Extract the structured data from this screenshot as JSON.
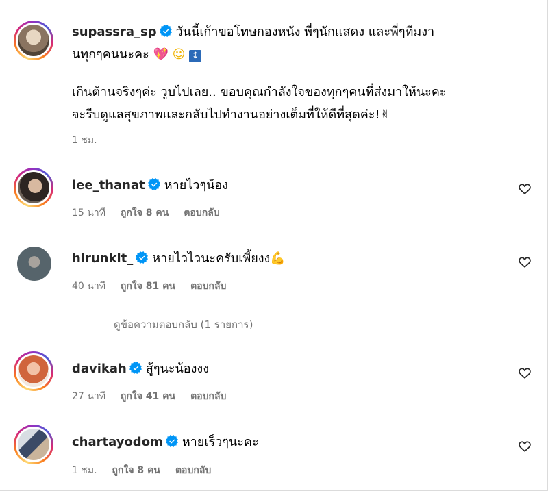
{
  "caption": {
    "username": "supassra_sp",
    "line1": "วันนี้เก้าขอโทษกองหนัง พี่ๆนักแสดง และพี่ๆทีมงา",
    "line2": "นทุกๆคนนะคะ",
    "line2_emoji_1": "💖",
    "line2_emoji_2": "☺",
    "line2_emoji_3": "↕",
    "line3": "เกินต้านจริงๆค่ะ วูบไปเลย.. ขอบคุณกำลังใจของทุกๆคนที่ส่งมาให้นะคะ",
    "line4": "จะรีบดูแลสุขภาพและกลับไปทำงานอย่างเต็มที่ให้ดีที่สุดค่ะ!✌",
    "time": "1 ชม."
  },
  "comments": [
    {
      "username": "lee_thanat",
      "text": "หายไวๆน้อง",
      "time": "15 นาที",
      "likes": "ถูกใจ 8 คน",
      "reply": "ตอบกลับ"
    },
    {
      "username": "hirunkit_",
      "text": "หายไวไวนะครับเพี้ยงง",
      "emoji": "💪",
      "time": "40 นาที",
      "likes": "ถูกใจ 81 คน",
      "reply": "ตอบกลับ",
      "view_replies": "ดูข้อความตอบกลับ (1 รายการ)"
    },
    {
      "username": "davikah",
      "text": "สู้ๆนะน้องงง",
      "time": "27 นาที",
      "likes": "ถูกใจ 41 คน",
      "reply": "ตอบกลับ"
    },
    {
      "username": "chartayodom",
      "text": "หายเร็วๆนะคะ",
      "time": "1 ชม.",
      "likes": "ถูกใจ 8 คน",
      "reply": "ตอบกลับ"
    }
  ],
  "icons": {
    "verified": "verified-badge-icon",
    "like": "heart-outline-icon"
  },
  "colors": {
    "verified": "#0095f6",
    "meta": "#737373",
    "username": "#262626"
  }
}
